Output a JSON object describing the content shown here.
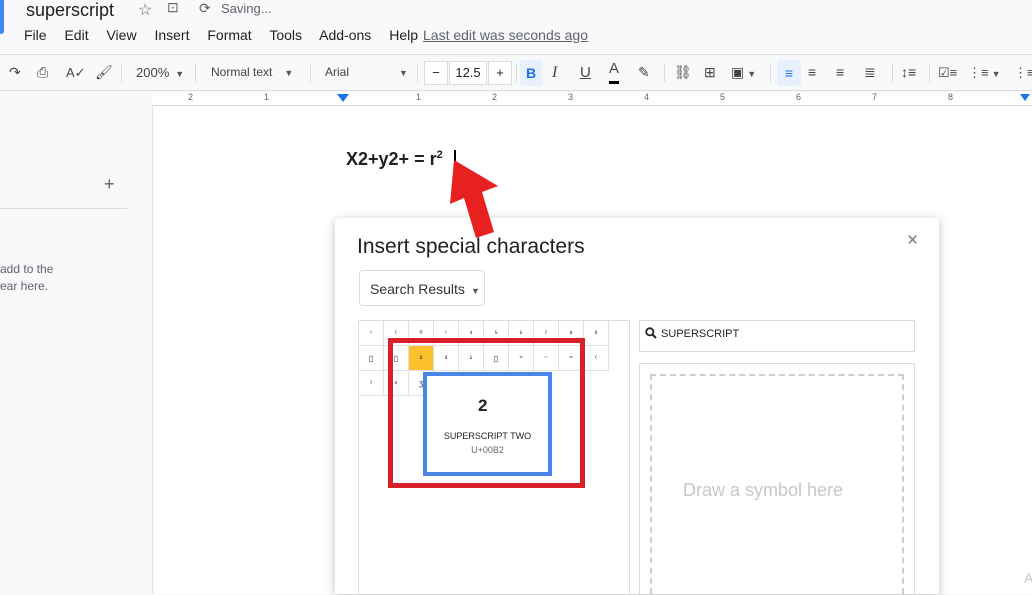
{
  "header": {
    "doc_title": "superscript",
    "save_status": "Saving...",
    "last_edit": "Last edit was seconds ago",
    "menu": [
      "File",
      "Edit",
      "View",
      "Insert",
      "Format",
      "Tools",
      "Add-ons",
      "Help"
    ]
  },
  "toolbar": {
    "zoom": "200%",
    "style": "Normal text",
    "font": "Arial",
    "font_size": "12.5",
    "minus": "−",
    "plus": "+",
    "bold": "B",
    "italic": "I",
    "underline": "U",
    "text_color": "A"
  },
  "ruler": {
    "labels": [
      "2",
      "1",
      "1",
      "2",
      "3",
      "4",
      "5",
      "6",
      "7",
      "8"
    ]
  },
  "outline": {
    "add": "+",
    "hint_line1": "add to the",
    "hint_line2": "ear here."
  },
  "document": {
    "text_main": "X2+y2+ = r",
    "text_sup": "2"
  },
  "dialog": {
    "title": "Insert special characters",
    "close": "×",
    "category": "Search Results",
    "search_value": "SUPERSCRIPT",
    "draw_hint": "Draw a symbol here",
    "grid_rows": [
      [
        "ⁱ",
        "⁽",
        "⁰",
        "ⁱ",
        "⁴",
        "⁵",
        "⁶",
        "⁷",
        "⁸",
        "⁹"
      ],
      [
        "▯",
        "▯",
        "²",
        "³",
        "¹",
        "▯",
        "⁺",
        "⁻",
        "⁼",
        "⁽"
      ],
      [
        "⁾",
        "ⁿ",
        "ʒ"
      ]
    ],
    "tooltip": {
      "glyph": "2",
      "name": "SUPERSCRIPT TWO",
      "code": "U+00B2"
    }
  },
  "watermark": "A",
  "colors": {
    "accent": "#1a73e8",
    "highlight_cell": "#fbc02d",
    "annotation_red": "#d8202a",
    "annotation_blue": "#4a86e8"
  }
}
